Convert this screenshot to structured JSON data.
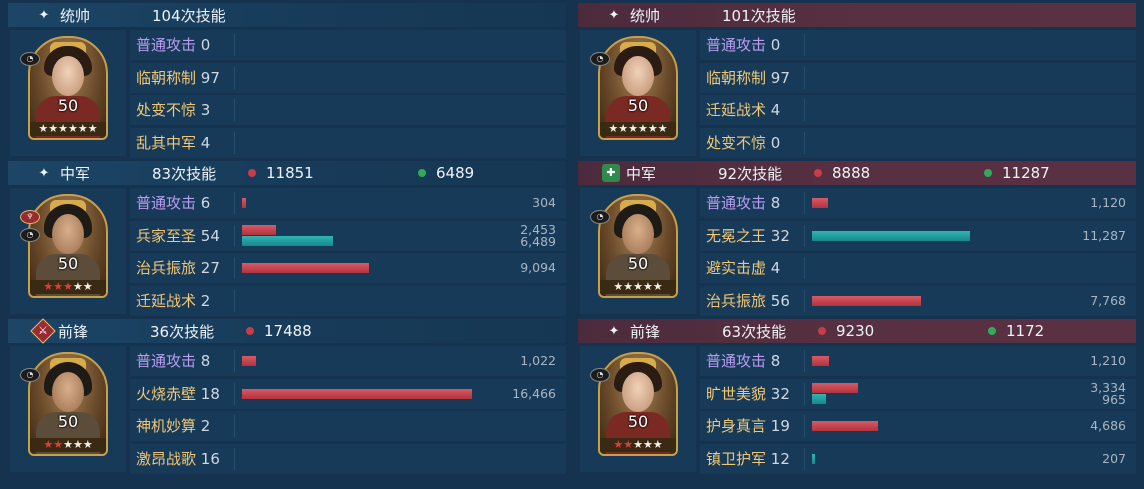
{
  "left": {
    "sections": [
      {
        "role": "统帅",
        "role_symbol": "✦",
        "skill_count": "104次技能",
        "damage": null,
        "heal": null,
        "hero": {
          "level": "50",
          "stars_red": 0,
          "stars_total": 6,
          "badges": [
            "mask-badge"
          ]
        },
        "skills": [
          {
            "name": "普通攻击",
            "count": "0",
            "basic": true,
            "bars": []
          },
          {
            "name": "临朝称制",
            "count": "97",
            "bars": []
          },
          {
            "name": "处变不惊",
            "count": "3",
            "bars": []
          },
          {
            "name": "乱其中军",
            "count": "4",
            "bars": []
          }
        ]
      },
      {
        "role": "中军",
        "role_symbol": "✦",
        "skill_count": "83次技能",
        "damage": "11851",
        "heal": "6489",
        "hero": {
          "level": "50",
          "stars_red": 3,
          "stars_total": 5,
          "badges": [
            "red-badge",
            "mask-badge"
          ]
        },
        "skills": [
          {
            "name": "普通攻击",
            "count": "6",
            "basic": true,
            "bars": [
              {
                "kind": "red",
                "fraction": 0.019,
                "label": "304"
              }
            ]
          },
          {
            "name": "兵家至圣",
            "count": "54",
            "bars": [
              {
                "kind": "red",
                "fraction": 0.149,
                "label": "2,453"
              },
              {
                "kind": "teal",
                "fraction": 0.394,
                "label": "6,489"
              }
            ]
          },
          {
            "name": "治兵振旅",
            "count": "27",
            "bars": [
              {
                "kind": "red",
                "fraction": 0.552,
                "label": "9,094"
              }
            ]
          },
          {
            "name": "迁延战术",
            "count": "2",
            "bars": []
          }
        ]
      },
      {
        "role": "前锋",
        "role_symbol": "⚔",
        "skill_count": "36次技能",
        "damage": "17488",
        "heal": null,
        "hero": {
          "level": "50",
          "stars_red": 2,
          "stars_total": 5,
          "badges": [
            "mask-badge"
          ]
        },
        "skills": [
          {
            "name": "普通攻击",
            "count": "8",
            "basic": true,
            "bars": [
              {
                "kind": "red",
                "fraction": 0.062,
                "label": "1,022"
              }
            ]
          },
          {
            "name": "火烧赤壁",
            "count": "18",
            "bars": [
              {
                "kind": "red",
                "fraction": 1.0,
                "label": "16,466"
              }
            ]
          },
          {
            "name": "神机妙算",
            "count": "2",
            "bars": []
          },
          {
            "name": "激昂战歌",
            "count": "16",
            "bars": []
          }
        ]
      }
    ]
  },
  "right": {
    "sections": [
      {
        "role": "统帅",
        "role_symbol": "✦",
        "skill_count": "101次技能",
        "damage": null,
        "heal": null,
        "hero": {
          "level": "50",
          "stars_red": 0,
          "stars_total": 6,
          "badges": [
            "mask-badge"
          ]
        },
        "skills": [
          {
            "name": "普通攻击",
            "count": "0",
            "basic": true,
            "bars": []
          },
          {
            "name": "临朝称制",
            "count": "97",
            "bars": []
          },
          {
            "name": "迁延战术",
            "count": "4",
            "bars": []
          },
          {
            "name": "处变不惊",
            "count": "0",
            "bars": []
          }
        ]
      },
      {
        "role": "中军",
        "role_symbol": "✚",
        "skill_count": "92次技能",
        "damage": "8888",
        "heal": "11287",
        "hero": {
          "level": "50",
          "stars_red": 0,
          "stars_total": 5,
          "badges": [
            "mask-badge"
          ]
        },
        "skills": [
          {
            "name": "普通攻击",
            "count": "8",
            "basic": true,
            "bars": [
              {
                "kind": "red",
                "fraction": 0.069,
                "label": "1,120"
              }
            ]
          },
          {
            "name": "无冕之王",
            "count": "32",
            "bars": [
              {
                "kind": "teal",
                "fraction": 0.686,
                "label": "11,287"
              }
            ]
          },
          {
            "name": "避实击虚",
            "count": "4",
            "bars": []
          },
          {
            "name": "治兵振旅",
            "count": "56",
            "bars": [
              {
                "kind": "red",
                "fraction": 0.472,
                "label": "7,768"
              }
            ]
          }
        ]
      },
      {
        "role": "前锋",
        "role_symbol": "✦",
        "skill_count": "63次技能",
        "damage": "9230",
        "heal": "1172",
        "hero": {
          "level": "50",
          "stars_red": 2,
          "stars_total": 5,
          "badges": [
            "mask-badge"
          ]
        },
        "skills": [
          {
            "name": "普通攻击",
            "count": "8",
            "basic": true,
            "bars": [
              {
                "kind": "red",
                "fraction": 0.074,
                "label": "1,210"
              }
            ]
          },
          {
            "name": "旷世美貌",
            "count": "32",
            "bars": [
              {
                "kind": "red",
                "fraction": 0.202,
                "label": "3,334"
              },
              {
                "kind": "teal",
                "fraction": 0.059,
                "label": "965"
              }
            ]
          },
          {
            "name": "护身真言",
            "count": "19",
            "bars": [
              {
                "kind": "red",
                "fraction": 0.285,
                "label": "4,686"
              }
            ]
          },
          {
            "name": "镇卫护军",
            "count": "12",
            "bars": [
              {
                "kind": "teal",
                "fraction": 0.013,
                "label": "207"
              }
            ]
          }
        ]
      }
    ]
  },
  "colors": {
    "damage": "#c63d48",
    "heal": "#35a85a",
    "basic_skill": "#b99cf0",
    "skill": "#f0c776"
  }
}
